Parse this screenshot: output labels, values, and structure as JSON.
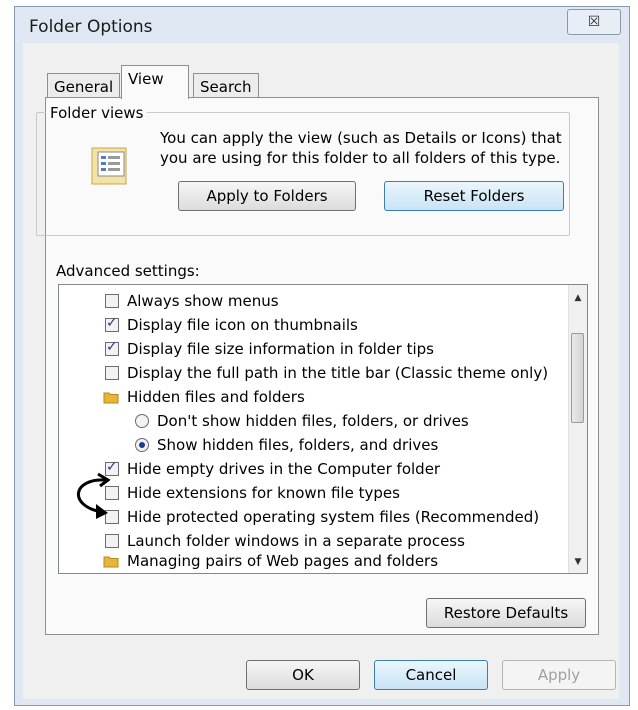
{
  "window": {
    "title": "Folder Options",
    "close_glyph": "☒"
  },
  "tabs": [
    {
      "label": "General",
      "active": false
    },
    {
      "label": "View",
      "active": true
    },
    {
      "label": "Search",
      "active": false
    }
  ],
  "folder_views": {
    "group_label": "Folder views",
    "description": "You can apply the view (such as Details or Icons) that you are using for this folder to all folders of this type.",
    "icon": "folder-details-icon",
    "apply_button": "Apply to Folders",
    "reset_button": "Reset Folders"
  },
  "advanced": {
    "label": "Advanced settings:",
    "items": [
      {
        "kind": "checkbox",
        "label": "Always show menus",
        "checked": false
      },
      {
        "kind": "checkbox",
        "label": "Display file icon on thumbnails",
        "checked": true
      },
      {
        "kind": "checkbox",
        "label": "Display file size information in folder tips",
        "checked": true
      },
      {
        "kind": "checkbox",
        "label": "Display the full path in the title bar (Classic theme only)",
        "checked": false
      },
      {
        "kind": "folder",
        "label": "Hidden files and folders"
      },
      {
        "kind": "radio",
        "label": "Don't show hidden files, folders, or drives",
        "checked": false
      },
      {
        "kind": "radio",
        "label": "Show hidden files, folders, and drives",
        "checked": true
      },
      {
        "kind": "checkbox",
        "label": "Hide empty drives in the Computer folder",
        "checked": true
      },
      {
        "kind": "checkbox",
        "label": "Hide extensions for known file types",
        "checked": false
      },
      {
        "kind": "checkbox",
        "label": "Hide protected operating system files (Recommended)",
        "checked": false
      },
      {
        "kind": "checkbox",
        "label": "Launch folder windows in a separate process",
        "checked": false
      },
      {
        "kind": "folder",
        "label": "Managing pairs of Web pages and folders"
      }
    ]
  },
  "buttons": {
    "restore_defaults": "Restore Defaults",
    "ok": "OK",
    "cancel": "Cancel",
    "apply": "Apply"
  },
  "colors": {
    "accent": "#1c3d8c",
    "focus_border": "#3c7fb1",
    "folder": "#e8b53a"
  }
}
